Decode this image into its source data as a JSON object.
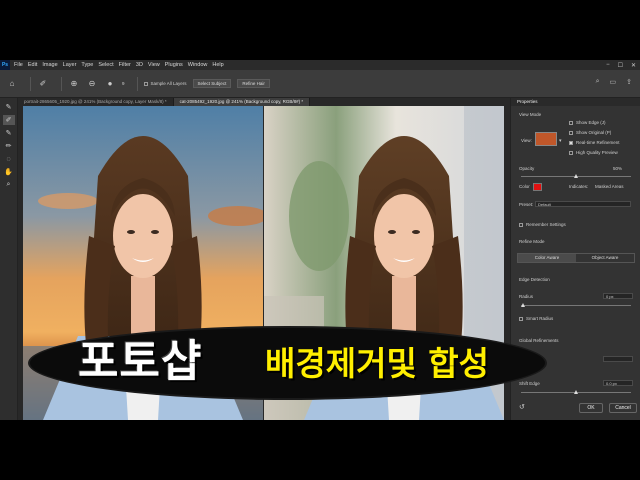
{
  "menubar": {
    "logo": "Ps",
    "items": [
      "File",
      "Edit",
      "Image",
      "Layer",
      "Type",
      "Select",
      "Filter",
      "3D",
      "View",
      "Plugins",
      "Window",
      "Help"
    ],
    "window_controls": [
      "−",
      "☐",
      "✕"
    ]
  },
  "options_bar": {
    "brush_size": "9",
    "sample_all_layers": "Sample All Layers",
    "select_subject": "Select Subject",
    "refine_hair": "Refine Hair"
  },
  "tabs": [
    {
      "label": "portrait-2865605_1920.jpg @ 241% (Background copy, Layer Mask/8) *",
      "active": false
    },
    {
      "label": "cat-2085492_1920.jpg @ 241% (Background copy, RGB/8#) *",
      "active": true
    }
  ],
  "panel": {
    "title": "Properties",
    "view_mode": "View Mode",
    "view_label": "View:",
    "show_edge": "Show Edge (J)",
    "show_original": "Show Original (P)",
    "realtime_refinement": "Real-time Refinement",
    "high_quality_preview": "High Quality Preview",
    "opacity_label": "Opacity",
    "opacity_value": "50%",
    "opacity_fraction": 0.5,
    "color_label": "Color",
    "color_value": "#e01010",
    "indicates_label": "Indicates:",
    "indicates_value": "Masked Areas",
    "preset_label": "Preset:",
    "preset_value": "Default",
    "remember_settings": "Remember Settings",
    "refine_mode": "Refine Mode",
    "mode_color_aware": "Color Aware",
    "mode_object_aware": "Object Aware",
    "edge_detection": "Edge Detection",
    "radius_label": "Radius",
    "radius_value": "0 px",
    "smart_radius": "Smart Radius",
    "global_refinements": "Global Refinements",
    "shift_edge_label": "Shift Edge",
    "shift_edge_value": "0.0 px",
    "ok": "OK",
    "cancel": "Cancel"
  },
  "banner": {
    "left_text": "포토샵",
    "right_text": "배경제거및 합성",
    "left_color": "#ffffff",
    "right_color": "#ffef00"
  }
}
